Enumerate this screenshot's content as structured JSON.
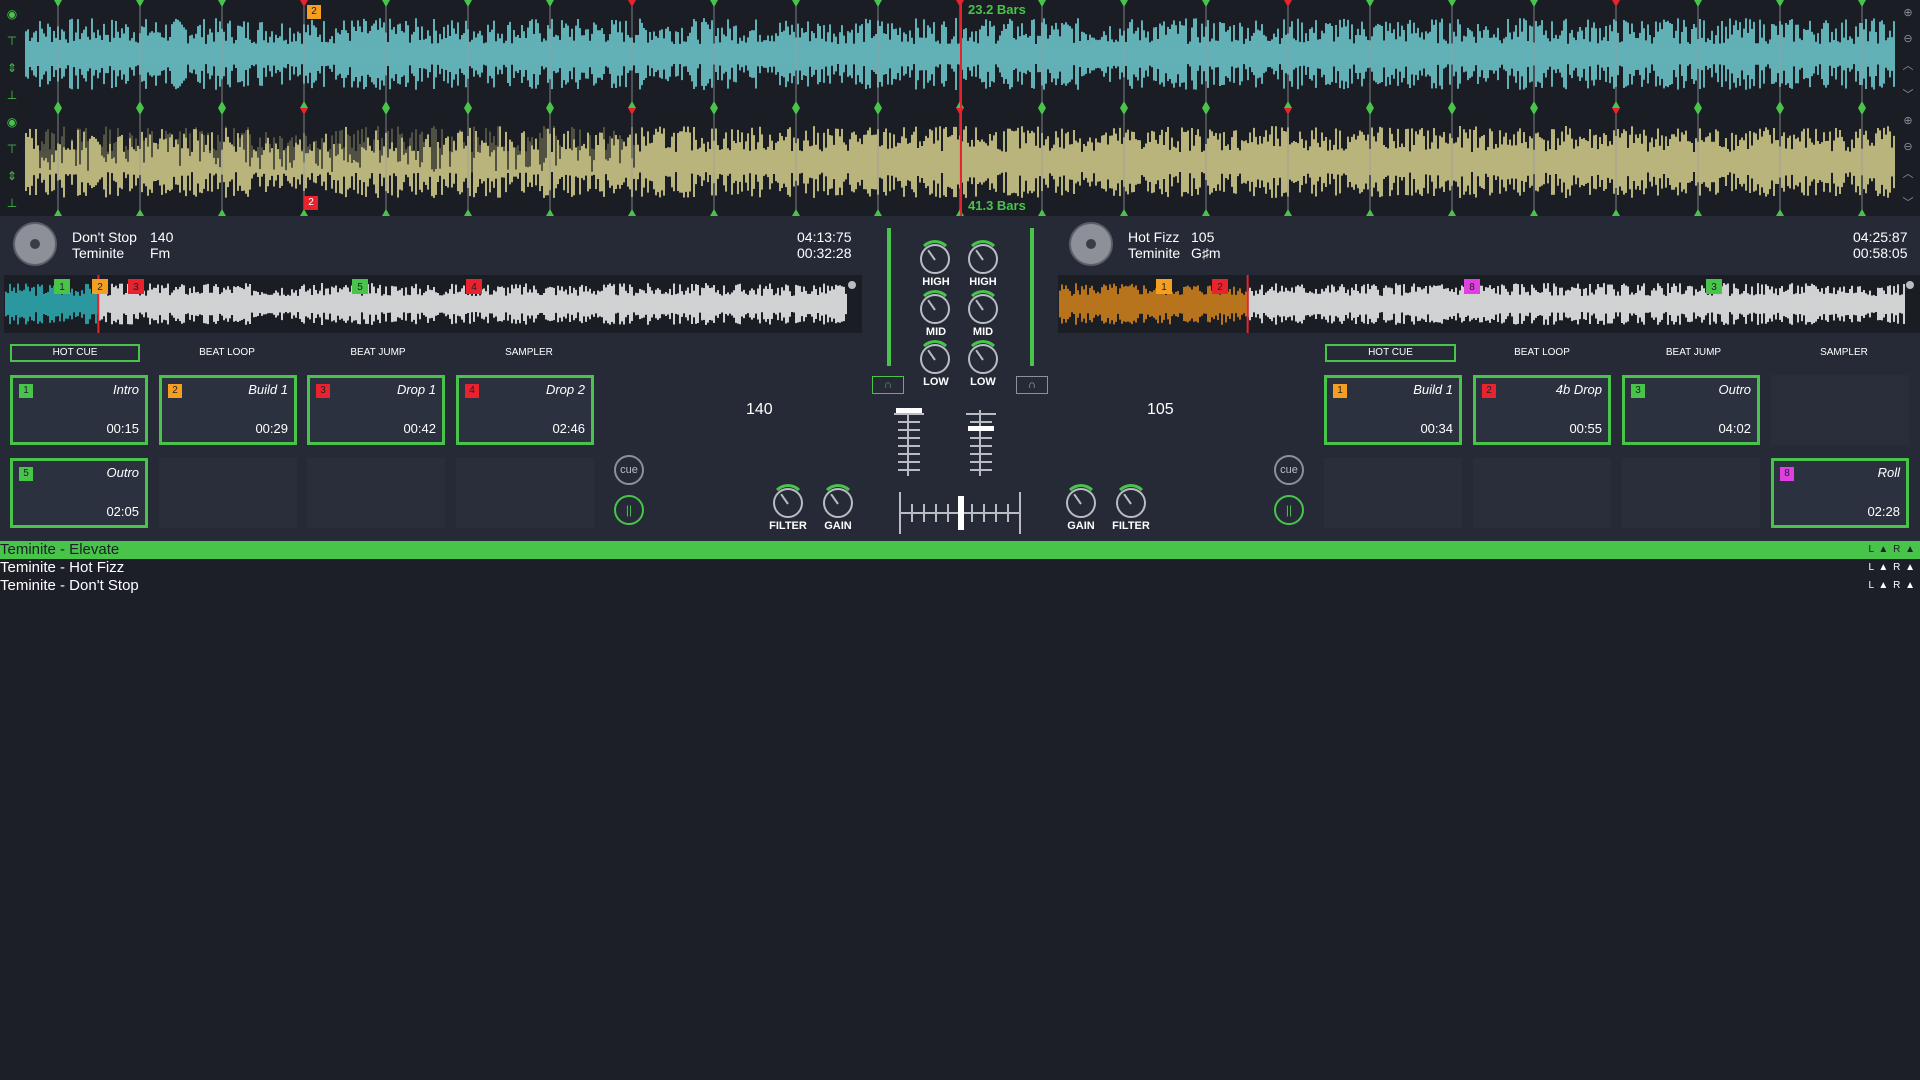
{
  "overview": {
    "deck_a_bars": "23.2 Bars",
    "deck_b_bars": "41.3 Bars",
    "deck_a_cue_marker": "2",
    "deck_b_cue_marker": "2",
    "colors": {
      "deck_a_wave": "#7ff0f6",
      "deck_b_wave": "#fdf5a2",
      "deck_b_wave_dark": "#f59e1f",
      "accent": "#48c44b",
      "marker_red": "#e8232d",
      "marker_orange": "#f59e1f"
    }
  },
  "deck_a": {
    "title": "Don't Stop",
    "artist": "Teminite",
    "bpm": "140",
    "key": "Fm",
    "total_time": "04:13:75",
    "elapsed": "00:32:28",
    "bpm_display": "140",
    "played_fraction": 0.11,
    "cue_markers": [
      {
        "label": "1",
        "color": "#48c44b"
      },
      {
        "label": "2",
        "color": "#f59e1f"
      },
      {
        "label": "3",
        "color": "#e8232d"
      },
      {
        "label": "5",
        "color": "#48c44b"
      },
      {
        "label": "4",
        "color": "#e8232d"
      }
    ],
    "tabs": [
      "HOT CUE",
      "BEAT LOOP",
      "BEAT JUMP",
      "SAMPLER"
    ],
    "active_tab": "HOT CUE",
    "pads": [
      {
        "num": "1",
        "name": "Intro",
        "time": "00:15",
        "color": "#48c44b"
      },
      {
        "num": "2",
        "name": "Build 1",
        "time": "00:29",
        "color": "#f59e1f"
      },
      {
        "num": "3",
        "name": "Drop 1",
        "time": "00:42",
        "color": "#e8232d"
      },
      {
        "num": "4",
        "name": "Drop 2",
        "time": "02:46",
        "color": "#e8232d"
      },
      {
        "num": "5",
        "name": "Outro",
        "time": "02:05",
        "color": "#48c44b"
      }
    ],
    "cue_btn": "cue",
    "play_btn": "||",
    "filter_label": "FILTER",
    "gain_label": "GAIN"
  },
  "deck_b": {
    "title": "Hot Fizz",
    "artist": "Teminite",
    "bpm": "105",
    "key": "G♯m",
    "total_time": "04:25:87",
    "elapsed": "00:58:05",
    "bpm_display": "105",
    "played_fraction": 0.22,
    "cue_markers": [
      {
        "label": "1",
        "color": "#f59e1f"
      },
      {
        "label": "2",
        "color": "#e8232d"
      },
      {
        "label": "8",
        "color": "#e040e0"
      },
      {
        "label": "3",
        "color": "#48c44b"
      }
    ],
    "tabs": [
      "HOT CUE",
      "BEAT LOOP",
      "BEAT JUMP",
      "SAMPLER"
    ],
    "active_tab": "HOT CUE",
    "pads": [
      {
        "num": "1",
        "name": "Build 1",
        "time": "00:34",
        "color": "#f59e1f"
      },
      {
        "num": "2",
        "name": "4b Drop",
        "time": "00:55",
        "color": "#e8232d"
      },
      {
        "num": "3",
        "name": "Outro",
        "time": "04:02",
        "color": "#48c44b"
      },
      {
        "num": "8",
        "name": "Roll",
        "time": "02:28",
        "color": "#e040e0"
      }
    ],
    "cue_btn": "cue",
    "play_btn": "||",
    "filter_label": "FILTER",
    "gain_label": "GAIN"
  },
  "mixer": {
    "eq_labels": [
      "HIGH",
      "MID",
      "LOW"
    ],
    "headphone_icon": "headphone-icon"
  },
  "playlist": [
    {
      "text": "Teminite - Elevate",
      "lr": "L ▲ R ▲",
      "active": true
    },
    {
      "text": "Teminite - Hot Fizz",
      "lr": "L ▲ R ▲",
      "active": false
    },
    {
      "text": "Teminite - Don't Stop",
      "lr": "L ▲ R ▲",
      "active": false
    }
  ]
}
